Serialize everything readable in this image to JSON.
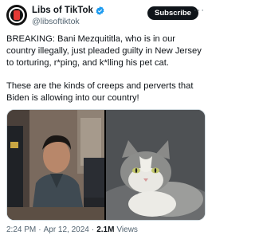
{
  "author": {
    "display_name": "Libs of TikTok",
    "handle": "@libsoftiktok",
    "verified": true
  },
  "actions": {
    "subscribe_label": "Subscribe",
    "more_label": "···"
  },
  "tweet": {
    "paragraph_1": "BREAKING: Bani Mezquititla, who is in our country illegally, just pleaded guilty in New Jersey to torturing, r*ping, and k*lling his pet cat.",
    "paragraph_2": "These are the kinds of creeps and perverts that Biden is allowing into our country!"
  },
  "meta": {
    "time": "2:24 PM",
    "separator_1": "·",
    "date": "Apr 12, 2024",
    "separator_2": "·",
    "views_count": "2.1M",
    "views_label": "Views"
  },
  "colors": {
    "accent": "#1d9bf0",
    "text": "#0f1419",
    "secondary": "#536471",
    "button": "#0f1419"
  }
}
